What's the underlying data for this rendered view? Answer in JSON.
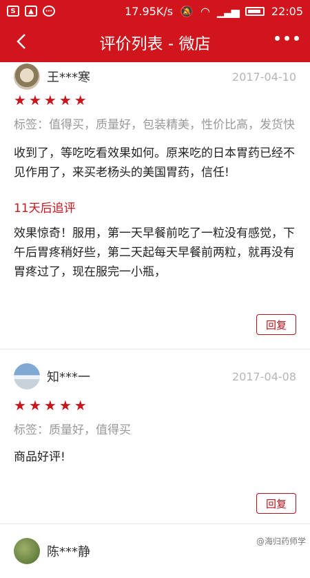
{
  "status_bar": {
    "left_icons": [
      "S",
      "img",
      "…"
    ],
    "network_speed": "17.95K/s",
    "time": "22:05"
  },
  "nav": {
    "title": "评价列表 - 微店",
    "back_icon": "chevron-left-icon",
    "more_icon": "more-dots-icon"
  },
  "reviews": [
    {
      "username": "王***寒",
      "date": "2017-04-10",
      "rating": 5,
      "tags": "标签：值得买，质量好，包装精美，性价比高，发货快",
      "content": "收到了，等吃吃看效果如何。原来吃的日本胃药已经不见作用了，来买老杨头的美国胃药，信任!",
      "followup_label": "11天后追评",
      "followup": "效果惊奇！服用，第一天早餐前吃了一粒没有感觉，下午后胃疼稍好些，第二天起每天早餐前两粒，就再没有胃疼过了，现在服完一小瓶，",
      "reply_label": "回复"
    },
    {
      "username": "知***一",
      "date": "2017-04-08",
      "rating": 5,
      "tags": "标签：质量好，值得买",
      "content": "商品好评!",
      "reply_label": "回复"
    },
    {
      "username": "陈***静"
    }
  ],
  "watermark": "@海归药师学"
}
